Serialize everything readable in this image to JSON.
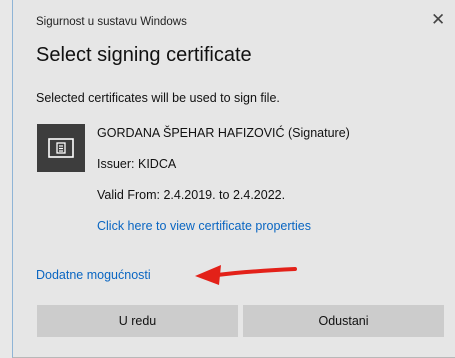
{
  "window": {
    "title": "Sigurnost u sustavu Windows",
    "close_glyph": "✕"
  },
  "dialog": {
    "heading": "Select signing certificate",
    "description": "Selected certificates will be used to sign file."
  },
  "certificate": {
    "icon": "certificate-icon",
    "name": "GORDANA ŠPEHAR HAFIZOVIĆ (Signature)",
    "issuer": "Issuer: KIDCA",
    "valid": "Valid From: 2.4.2019. to 2.4.2022.",
    "properties_link": "Click here to view certificate properties"
  },
  "more_options_link": "Dodatne mogućnosti",
  "annotation": {
    "arrow_color": "#e32119"
  },
  "buttons": {
    "ok": "U redu",
    "cancel": "Odustani"
  },
  "colors": {
    "link": "#0a66c2",
    "button_bg": "#cccccc",
    "icon_bg": "#3d3d3d"
  }
}
